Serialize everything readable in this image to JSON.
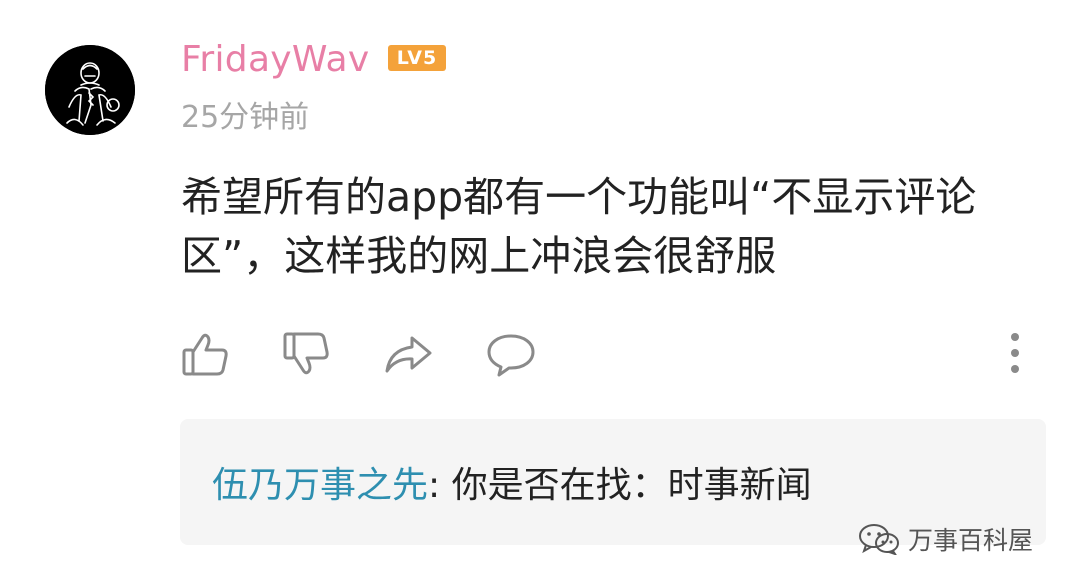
{
  "comment": {
    "username": "FridayWav",
    "level_badge": "LV5",
    "timestamp": "25分钟前",
    "text": "希望所有的app都有一个功能叫“不显示评论区”，这样我的网上冲浪会很舒服"
  },
  "actions": {
    "icons": [
      "thumbs-up-icon",
      "thumbs-down-icon",
      "share-icon",
      "reply-icon",
      "more-icon"
    ]
  },
  "suggestion": {
    "author": "伍乃万事之先",
    "colon": ":",
    "text": " 你是否在找：时事新闻"
  },
  "watermark": {
    "label": "万事百科屋"
  },
  "colors": {
    "username": "#e87fa6",
    "badge": "#f4a23a",
    "link": "#2e8fb0",
    "icon": "#8a8a8a"
  }
}
